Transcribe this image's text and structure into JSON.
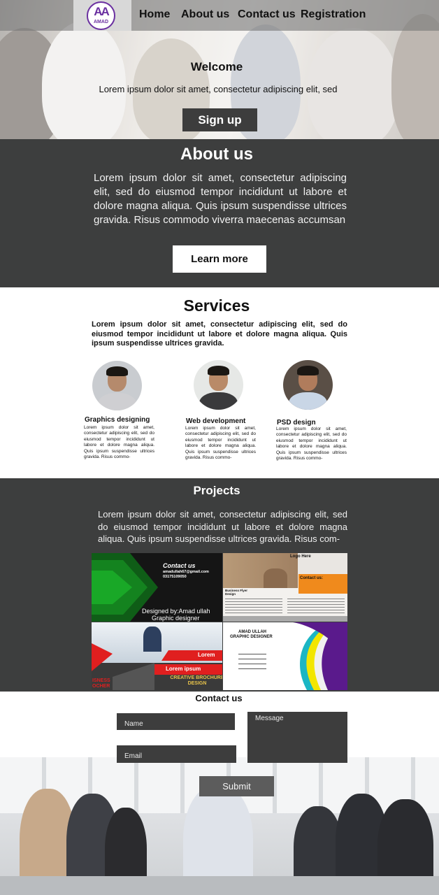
{
  "nav": {
    "logo_mark": "AA",
    "logo_text": "AMAD",
    "links": [
      "Home",
      "About us",
      "Contact us",
      "Registration"
    ]
  },
  "hero": {
    "title": "Welcome",
    "text": "Lorem ipsum dolor sit amet, consectetur adipiscing elit, sed",
    "button": "Sign up"
  },
  "about": {
    "title": "About us",
    "text": "Lorem ipsum dolor sit amet, consectetur adipiscing elit, sed do eiusmod tempor incididunt ut labore et dolore magna aliqua. Quis ipsum suspendisse ultrices gravida. Risus commodo viverra maecenas accumsan",
    "button": "Learn more"
  },
  "services": {
    "title": "Services",
    "text": "Lorem ipsum dolor sit amet, consectetur adipiscing elit, sed do eiusmod tempor incididunt ut labore et dolore magna aliqua. Quis ipsum suspendisse ultrices gravida.",
    "items": [
      {
        "title": "Graphics designing",
        "text": "Lorem ipsum dolor sit amet, consectetur adipiscing elit, sed do eiusmod tempor incididunt ut labore et dolore magna aliqua. Quis ipsum suspendisse ultrices gravida. Risus commo-"
      },
      {
        "title": "Web development",
        "text": "Lorem ipsum dolor sit amet, consectetur adipiscing elit, sed do eiusmod tempor incididunt ut labore et dolore magna aliqua. Quis ipsum suspendisse ultrices gravida. Risus commo-"
      },
      {
        "title": "PSD design",
        "text": "Lorem ipsum dolor sit amet, consectetur adipiscing elit, sed do eiusmod tempor incididunt ut labore et dolore magna aliqua. Quis ipsum suspendisse ultrices gravida. Risus commo-"
      }
    ]
  },
  "projects": {
    "title": "Projects",
    "text": "Lorem ipsum dolor sit amet, consectetur adipiscing elit, sed do eiusmod tempor incididunt ut labore et dolore magna aliqua. Quis ipsum suspendisse ultrices gravida. Risus com-",
    "card1": {
      "heading": "Contact us",
      "email": "amadullah67@gmail.com",
      "phone": "03175109050",
      "credit": "Designed by:Amad ullah",
      "role": "Graphic designer"
    },
    "card2": {
      "logo": "Logo Here",
      "contact": "Contact us:",
      "label": "Business Flyer Design"
    },
    "card3": {
      "banner1": "Lorem",
      "banner2": "Lorem ipsum",
      "brochure": "CREATIVE BROCHURE DESIGN",
      "left": "ISNESS OCHER"
    },
    "card4": {
      "name": "AMAD ULLAH",
      "role": "GRAPHIC DESIGNER"
    }
  },
  "contact": {
    "title": "Contact us",
    "name_placeholder": "Name",
    "email_placeholder": "Email",
    "message_placeholder": "Message",
    "submit": "Submit"
  },
  "colors": {
    "dark": "#3d3e3e",
    "logo_purple": "#6a2fa0"
  }
}
